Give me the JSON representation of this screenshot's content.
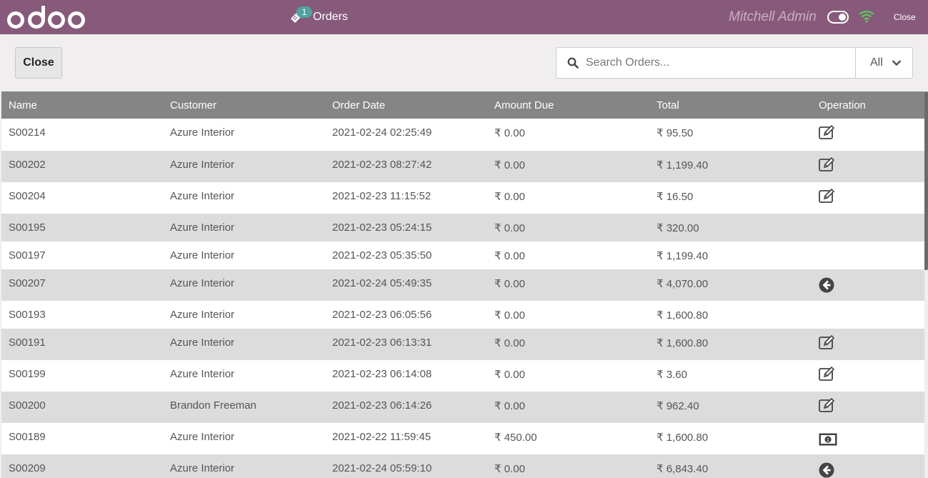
{
  "header": {
    "tab_label": "Orders",
    "tab_badge": "1",
    "user_name": "Mitchell Admin",
    "close_label": "Close",
    "brand_color": "#875a7b"
  },
  "toolbar": {
    "close_button_label": "Close",
    "search_placeholder": "Search Orders...",
    "filter_label": "All"
  },
  "table": {
    "columns": [
      "Name",
      "Customer",
      "Order Date",
      "Amount Due",
      "Total",
      "Operation"
    ],
    "rows": [
      {
        "name": "S00214",
        "customer": "Azure Interior",
        "date": "2021-02-24 02:25:49",
        "due": "₹ 0.00",
        "total": "₹ 95.50",
        "op": "edit-icon"
      },
      {
        "name": "S00202",
        "customer": "Azure Interior",
        "date": "2021-02-23 08:27:42",
        "due": "₹ 0.00",
        "total": "₹ 1,199.40",
        "op": "edit-icon"
      },
      {
        "name": "S00204",
        "customer": "Azure Interior",
        "date": "2021-02-23 11:15:52",
        "due": "₹ 0.00",
        "total": "₹ 16.50",
        "op": "edit-icon"
      },
      {
        "name": "S00195",
        "customer": "Azure Interior",
        "date": "2021-02-23 05:24:15",
        "due": "₹ 0.00",
        "total": "₹ 320.00",
        "op": ""
      },
      {
        "name": "S00197",
        "customer": "Azure Interior",
        "date": "2021-02-23 05:35:50",
        "due": "₹ 0.00",
        "total": "₹ 1,199.40",
        "op": ""
      },
      {
        "name": "S00207",
        "customer": "Azure Interior",
        "date": "2021-02-24 05:49:35",
        "due": "₹ 0.00",
        "total": "₹ 4,070.00",
        "op": "return-icon"
      },
      {
        "name": "S00193",
        "customer": "Azure Interior",
        "date": "2021-02-23 06:05:56",
        "due": "₹ 0.00",
        "total": "₹ 1,600.80",
        "op": ""
      },
      {
        "name": "S00191",
        "customer": "Azure Interior",
        "date": "2021-02-23 06:13:31",
        "due": "₹ 0.00",
        "total": "₹ 1,600.80",
        "op": "edit-icon"
      },
      {
        "name": "S00199",
        "customer": "Azure Interior",
        "date": "2021-02-23 06:14:08",
        "due": "₹ 0.00",
        "total": "₹ 3.60",
        "op": "edit-icon"
      },
      {
        "name": "S00200",
        "customer": "Brandon Freeman",
        "date": "2021-02-23 06:14:26",
        "due": "₹ 0.00",
        "total": "₹ 962.40",
        "op": "edit-icon"
      },
      {
        "name": "S00189",
        "customer": "Azure Interior",
        "date": "2021-02-22 11:59:45",
        "due": "₹ 450.00",
        "total": "₹ 1,600.80",
        "op": "money-icon"
      },
      {
        "name": "S00209",
        "customer": "Azure Interior",
        "date": "2021-02-24 05:59:10",
        "due": "₹ 0.00",
        "total": "₹ 6,843.40",
        "op": "return-icon"
      }
    ]
  }
}
